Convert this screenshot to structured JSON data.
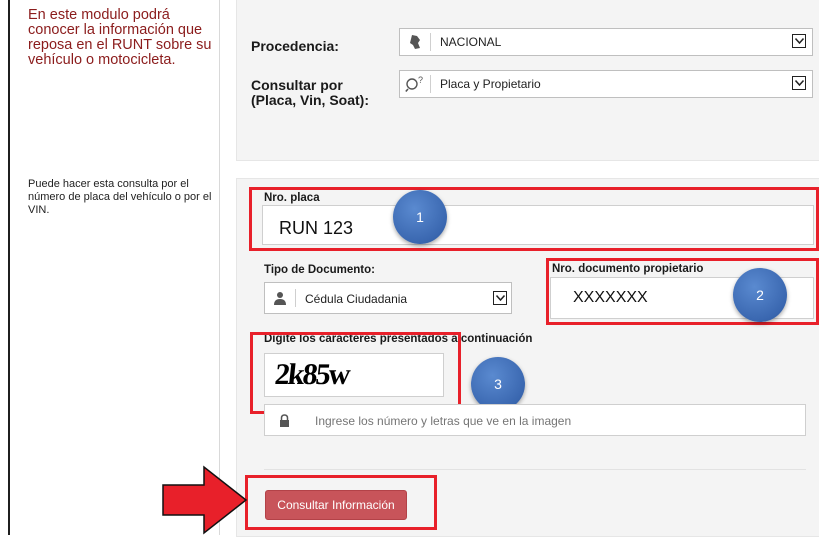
{
  "sidebar": {
    "intro": "En este modulo podrá conocer la información que reposa en el RUNT sobre su vehículo o motocicleta.",
    "help": "Puede hacer esta consulta por el número de placa del vehículo o por el VIN."
  },
  "form_top": {
    "procedencia_label": "Procedencia:",
    "procedencia_value": "NACIONAL",
    "consultar_label": "Consultar por (Placa, Vin, Soat):",
    "consultar_value": "Placa y Propietario"
  },
  "form_bottom": {
    "placa_label": "Nro. placa",
    "placa_value": "RUN 123",
    "tipo_doc_label": "Tipo de Documento:",
    "tipo_doc_value": "Cédula Ciudadania",
    "nro_doc_label": "Nro. documento propietario",
    "nro_doc_value": "XXXXXXX",
    "captcha_label": "Digite los caracteres presentados a continuación",
    "captcha_text": "2k85w",
    "captcha_placeholder": "Ingrese los número y letras que ve en la imagen",
    "submit_label": "Consultar Información"
  },
  "annotations": {
    "badge_1": "1",
    "badge_2": "2",
    "badge_3": "3",
    "highlight_color": "#e8202a",
    "badge_color": "#3a67b0",
    "arrow_color": "#e8202a"
  }
}
